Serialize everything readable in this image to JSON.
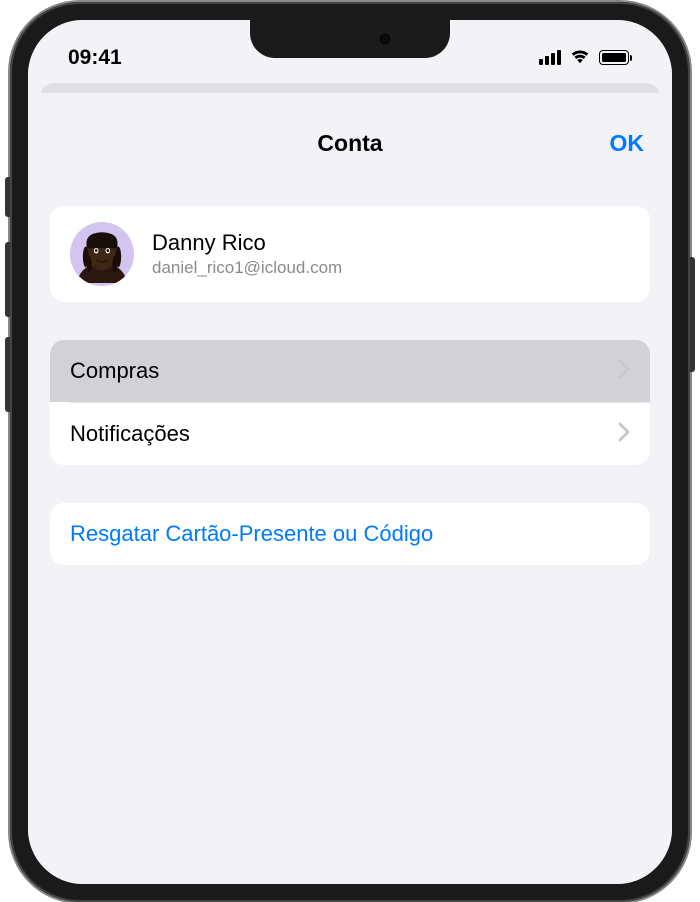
{
  "statusBar": {
    "time": "09:41"
  },
  "modal": {
    "title": "Conta",
    "doneButton": "OK"
  },
  "profile": {
    "name": "Danny Rico",
    "email": "daniel_rico1@icloud.com"
  },
  "menu": {
    "purchases": "Compras",
    "notifications": "Notificações"
  },
  "actions": {
    "redeem": "Resgatar Cartão-Presente ou Código"
  }
}
